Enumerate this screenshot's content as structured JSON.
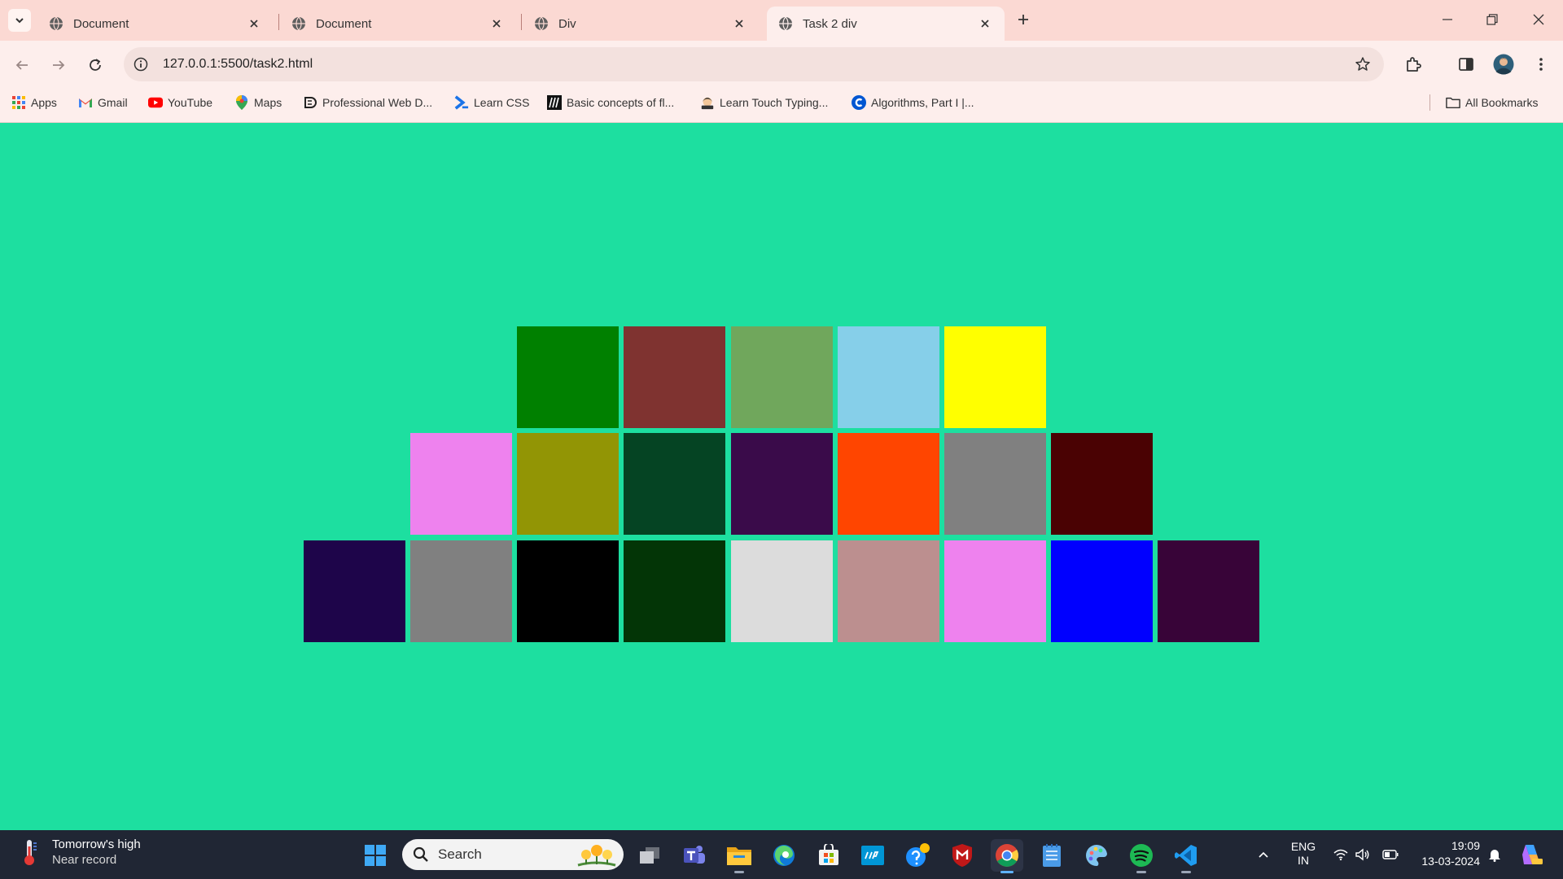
{
  "browser": {
    "tabs": [
      {
        "title": "Document",
        "active": false
      },
      {
        "title": "Document",
        "active": false
      },
      {
        "title": "Div",
        "active": false
      },
      {
        "title": "Task 2 div",
        "active": true
      }
    ],
    "url": "127.0.0.1:5500/task2.html",
    "bookmarks": [
      {
        "label": "Apps",
        "icon": "apps-grid-icon"
      },
      {
        "label": "Gmail",
        "icon": "gmail-icon"
      },
      {
        "label": "YouTube",
        "icon": "youtube-icon"
      },
      {
        "label": "Maps",
        "icon": "maps-pin-icon"
      },
      {
        "label": "Professional Web D...",
        "icon": "site-icon"
      },
      {
        "label": "Learn CSS",
        "icon": "css-icon"
      },
      {
        "label": "Basic concepts of fl...",
        "icon": "mdn-icon"
      },
      {
        "label": "Learn Touch Typing...",
        "icon": "typing-icon"
      },
      {
        "label": "Algorithms, Part I |...",
        "icon": "coursera-icon"
      }
    ],
    "all_bookmarks_label": "All Bookmarks"
  },
  "page": {
    "background": "#1ddfa0",
    "grid": [
      {
        "row": "top",
        "colors": [
          "#008000",
          "#7f3330",
          "#70a75c",
          "#86cfe9",
          "#ffff00"
        ]
      },
      {
        "row": "middle",
        "colors": [
          "#ee82ee",
          "#929505",
          "#054423",
          "#3a0b4a",
          "#ff4500",
          "#808080",
          "#4a0203"
        ]
      },
      {
        "row": "bottom",
        "colors": [
          "#1e054a",
          "#808080",
          "#000000",
          "#033506",
          "#dcdcdc",
          "#bc8f8f",
          "#ee82ee",
          "#0000ff",
          "#380438"
        ]
      }
    ]
  },
  "taskbar": {
    "weather": {
      "line1": "Tomorrow's high",
      "line2": "Near record"
    },
    "search_placeholder": "Search",
    "apps": [
      "windows-start-icon",
      "task-view-icon",
      "teams-icon",
      "file-explorer-icon",
      "edge-icon",
      "store-icon",
      "myhp-icon",
      "help-icon",
      "mcafee-icon",
      "chrome-icon",
      "notepad-icon",
      "paint-icon",
      "spotify-icon",
      "vscode-icon"
    ],
    "lang_line1": "ENG",
    "lang_line2": "IN",
    "time": "19:09",
    "date": "13-03-2024"
  }
}
